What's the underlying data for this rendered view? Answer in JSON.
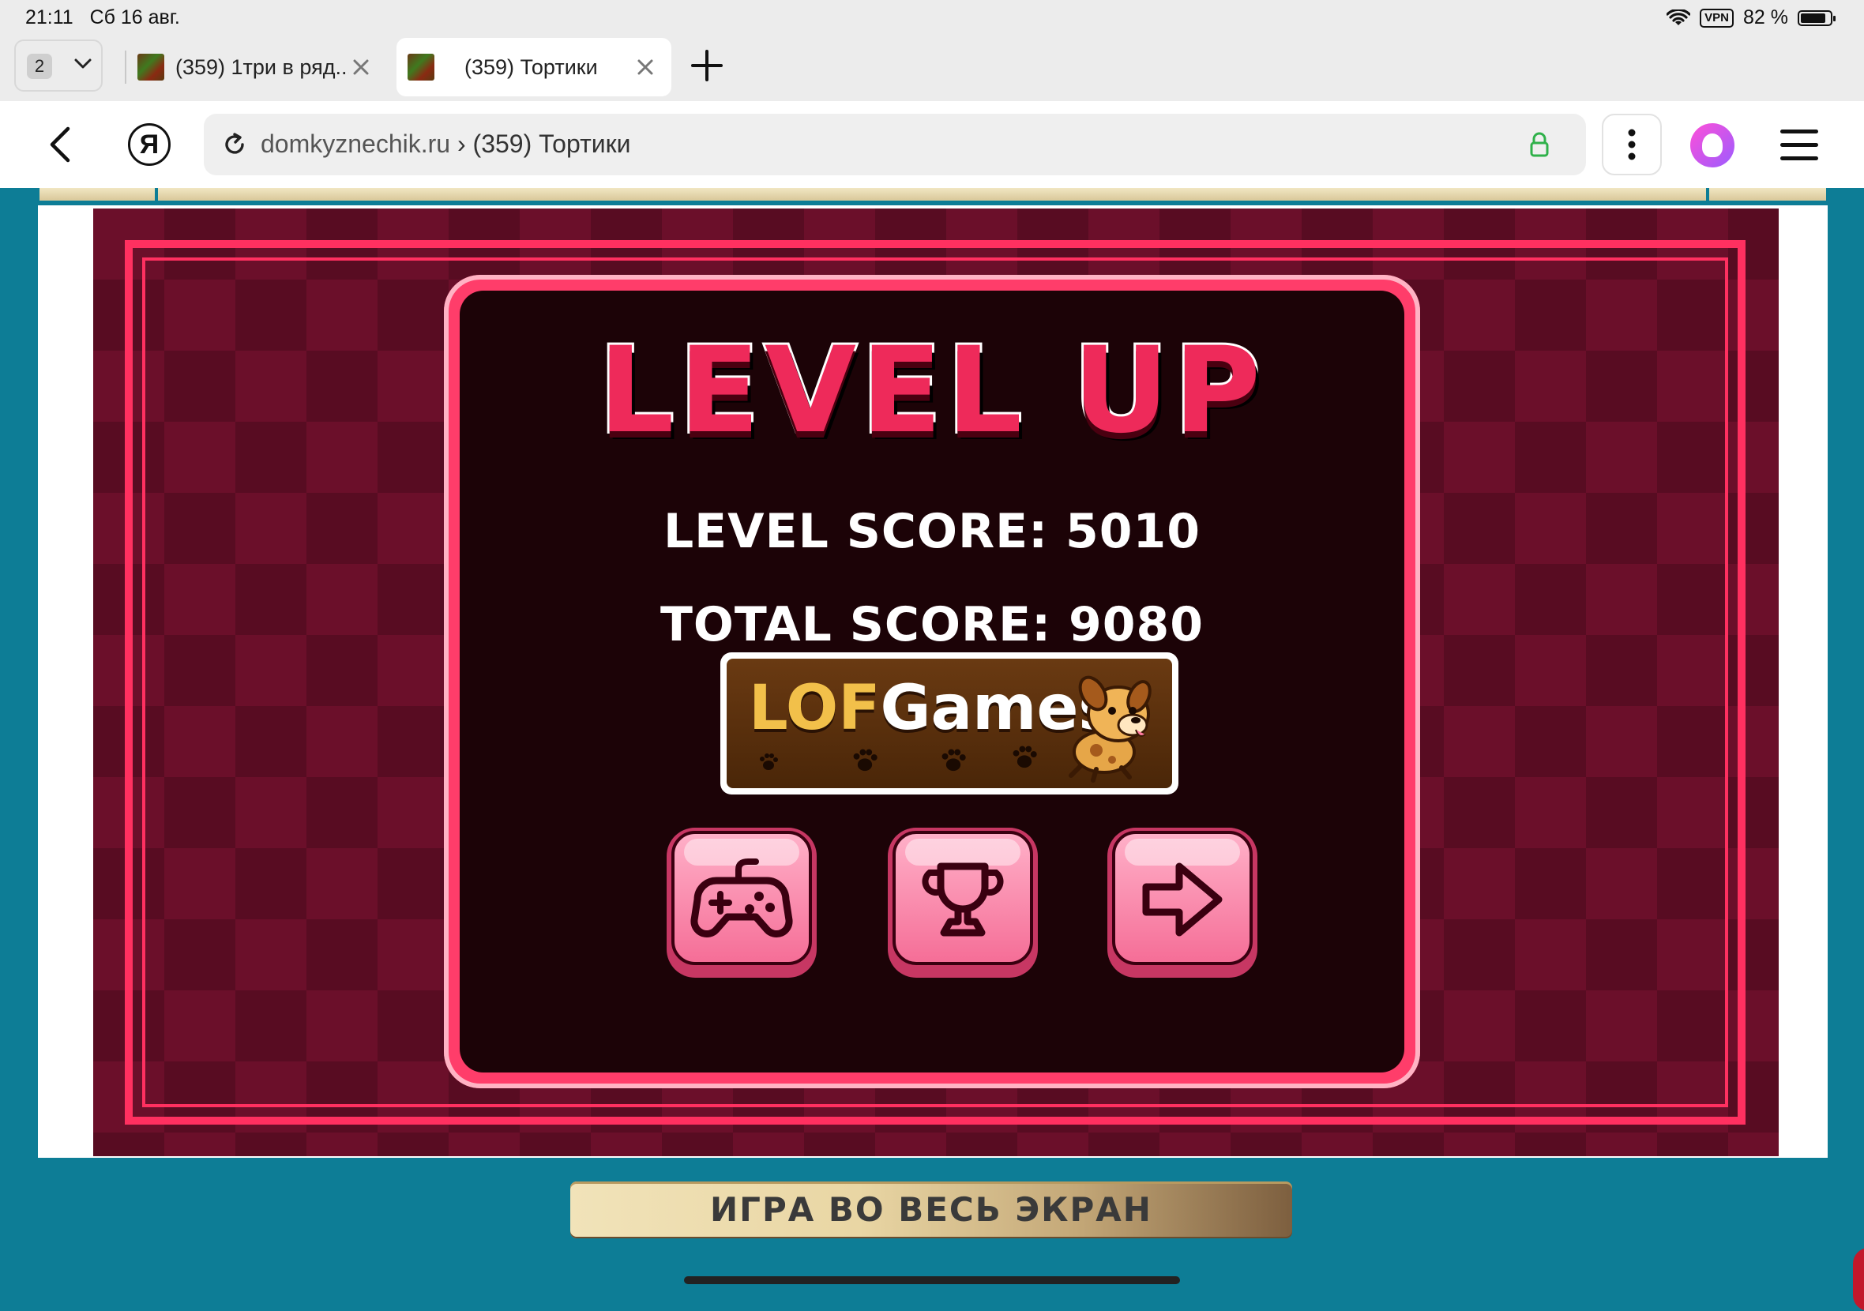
{
  "status_bar": {
    "time": "21:11",
    "date": "Сб 16 авг.",
    "vpn": "VPN",
    "battery": "82 %",
    "battery_level": 0.82
  },
  "tabs": {
    "count": "2",
    "items": [
      {
        "title": "(359) 1три в ряд..."
      },
      {
        "title": "(359) Тортики"
      }
    ]
  },
  "address_bar": {
    "domain": "domkyznechik.ru",
    "separator": "›",
    "page_title": "(359) Тортики",
    "logo_letter": "Я"
  },
  "game": {
    "title": "LEVEL UP",
    "level_score_label": "LEVEL SCORE: 5010",
    "total_score_label": "TOTAL SCORE: 9080",
    "logo_lof": "LOF",
    "logo_games": "Games",
    "buttons": [
      {
        "icon": "gamepad-icon"
      },
      {
        "icon": "trophy-icon"
      },
      {
        "icon": "arrow-right-icon"
      }
    ],
    "colors": {
      "accent": "#ff3060",
      "panel": "#1c0307",
      "background": "#6b0f2a"
    }
  },
  "fullscreen_button": {
    "label": "ИГРА ВО ВЕСЬ ЭКРАН"
  }
}
